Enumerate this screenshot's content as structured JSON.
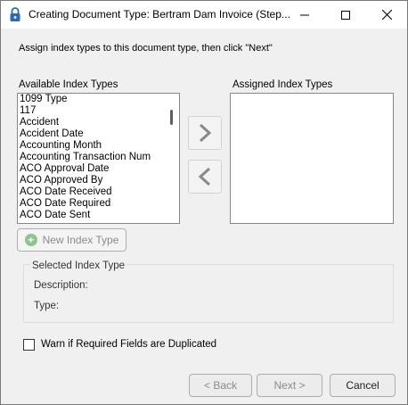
{
  "window": {
    "title": "Creating Document Type: Bertram Dam Invoice (Step...",
    "controls": {
      "minimize_icon": "minimize-icon",
      "maximize_icon": "maximize-icon",
      "close_icon": "close-icon"
    }
  },
  "instruction": "Assign index types to this document type, then click \"Next\"",
  "available": {
    "label": "Available Index Types",
    "items": [
      "1099 Type",
      "117",
      "Accident",
      "Accident Date",
      "Accounting Month",
      "Accounting Transaction Num",
      "ACO Approval Date",
      "ACO Approved By",
      "ACO Date Received",
      "ACO Date Required",
      "ACO Date Sent"
    ]
  },
  "assigned": {
    "label": "Assigned Index Types",
    "items": []
  },
  "buttons": {
    "new_index_type": "New Index Type",
    "back": "< Back",
    "next": "Next >",
    "cancel": "Cancel"
  },
  "selected_index": {
    "title": "Selected Index Type",
    "description_label": "Description:",
    "type_label": "Type:"
  },
  "warn_checkbox": {
    "label": "Warn if Required Fields are Duplicated",
    "checked": false
  },
  "colors": {
    "window_bg": "#f0f0f0",
    "disabled_text": "#8a8a8a",
    "plus_green": "#8fc48f"
  }
}
